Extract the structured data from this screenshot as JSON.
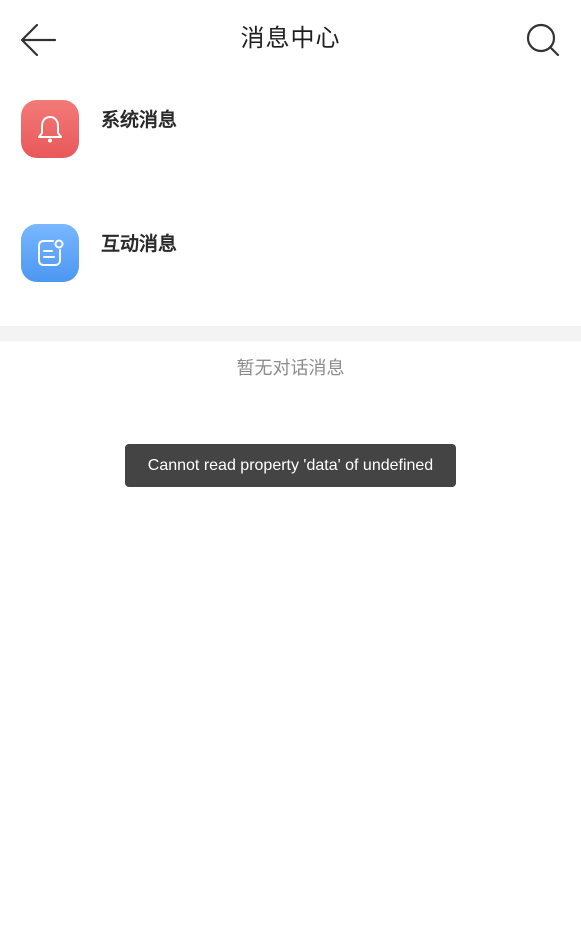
{
  "header": {
    "title": "消息中心",
    "back_icon": "arrow-left-icon",
    "search_icon": "search-icon"
  },
  "categories": [
    {
      "label": "系统消息",
      "icon": "bell-icon",
      "color": "#ec6365"
    },
    {
      "label": "互动消息",
      "icon": "chat-note-icon",
      "color": "#5da5f6"
    }
  ],
  "conversations": {
    "empty_text": "暂无对话消息"
  },
  "toast": {
    "message": "Cannot read property 'data' of undefined"
  }
}
